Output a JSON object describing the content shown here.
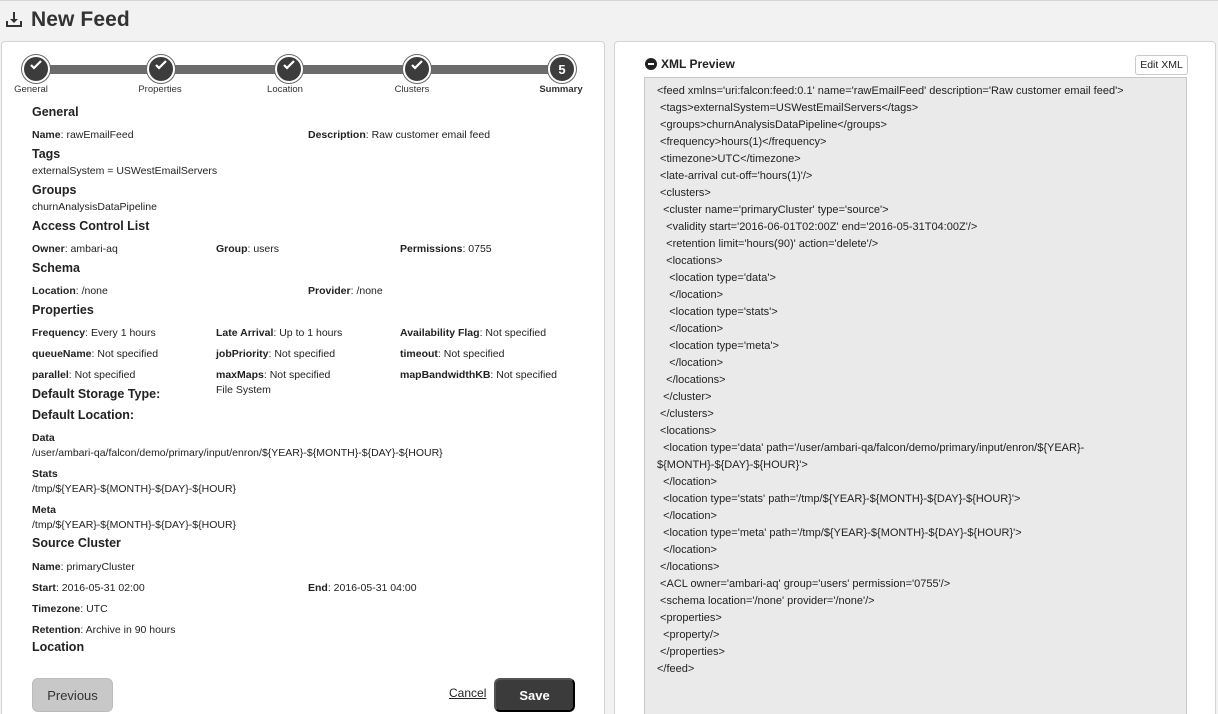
{
  "header": {
    "title": "New Feed",
    "icon": "download-tray-icon"
  },
  "wizard": {
    "steps": [
      {
        "label": "General",
        "state": "done"
      },
      {
        "label": "Properties",
        "state": "done"
      },
      {
        "label": "Location",
        "state": "done"
      },
      {
        "label": "Clusters",
        "state": "done"
      },
      {
        "label": "Summary",
        "state": "current",
        "number": "5"
      }
    ]
  },
  "summary": {
    "general": {
      "title": "General",
      "name_label": "Name",
      "name_value": ": rawEmailFeed",
      "description_label": "Description",
      "description_value": ": Raw customer email feed"
    },
    "tags": {
      "title": "Tags",
      "value": "externalSystem = USWestEmailServers"
    },
    "groups": {
      "title": "Groups",
      "value": "churnAnalysisDataPipeline"
    },
    "acl": {
      "title": "Access Control List",
      "owner_label": "Owner",
      "owner_value": ": ambari-aq",
      "group_label": "Group",
      "group_value": ": users",
      "permissions_label": "Permissions",
      "permissions_value": ": 0755"
    },
    "schema": {
      "title": "Schema",
      "location_label": "Location",
      "location_value": ": /none",
      "provider_label": "Provider",
      "provider_value": ": /none"
    },
    "properties": {
      "title": "Properties",
      "frequency_label": "Frequency",
      "frequency_value": ": Every 1 hours",
      "late_arrival_label": "Late Arrival",
      "late_arrival_value": ": Up to 1 hours",
      "availability_label": "Availability Flag",
      "availability_value": ": Not specified",
      "queue_label": "queueName",
      "queue_value": ": Not specified",
      "priority_label": "jobPriority",
      "priority_value": ": Not specified",
      "timeout_label": "timeout",
      "timeout_value": ": Not specified",
      "parallel_label": "parallel",
      "parallel_value": ": Not specified",
      "maxmaps_label": "maxMaps",
      "maxmaps_value": ": Not specified",
      "bandwidth_label": "mapBandwidthKB",
      "bandwidth_value": ": Not specified"
    },
    "storage_type": {
      "title": "Default Storage Type:",
      "value": "File System"
    },
    "default_location": {
      "title": "Default Location:",
      "data_label": "Data",
      "data_value": "/user/ambari-qa/falcon/demo/primary/input/enron/${YEAR}-${MONTH}-${DAY}-${HOUR}",
      "stats_label": "Stats",
      "stats_value": "/tmp/${YEAR}-${MONTH}-${DAY}-${HOUR}",
      "meta_label": "Meta",
      "meta_value": "/tmp/${YEAR}-${MONTH}-${DAY}-${HOUR}"
    },
    "source_cluster": {
      "title": "Source Cluster",
      "name_label": "Name",
      "name_value": ": primaryCluster",
      "start_label": "Start",
      "start_value": ": 2016-05-31 02:00",
      "end_label": "End",
      "end_value": ": 2016-05-31 04:00",
      "timezone_label": "Timezone",
      "timezone_value": ": UTC",
      "retention_label": "Retention",
      "retention_value": ": Archive in 90 hours"
    },
    "location": {
      "title": "Location"
    }
  },
  "actions": {
    "previous": "Previous",
    "cancel": "Cancel",
    "save": "Save"
  },
  "xml_preview": {
    "title": "XML Preview",
    "edit_label": "Edit XML",
    "lines": [
      "<feed xmlns='uri:falcon:feed:0.1' name='rawEmailFeed' description='Raw customer email feed'>",
      " <tags>externalSystem=USWestEmailServers</tags>",
      " <groups>churnAnalysisDataPipeline</groups>",
      " <frequency>hours(1)</frequency>",
      " <timezone>UTC</timezone>",
      " <late-arrival cut-off='hours(1)'/>",
      " <clusters>",
      "  <cluster name='primaryCluster' type='source'>",
      "   <validity start='2016-06-01T02:00Z' end='2016-05-31T04:00Z'/>",
      "   <retention limit='hours(90)' action='delete'/>",
      "   <locations>",
      "    <location type='data'>",
      "    </location>",
      "    <location type='stats'>",
      "    </location>",
      "    <location type='meta'>",
      "    </location>",
      "   </locations>",
      "  </cluster>",
      " </clusters>",
      " <locations>",
      "  <location type='data' path='/user/ambari-qa/falcon/demo/primary/input/enron/${YEAR}-",
      "${MONTH}-${DAY}-${HOUR}'>",
      "  </location>",
      "  <location type='stats' path='/tmp/${YEAR}-${MONTH}-${DAY}-${HOUR}'>",
      "  </location>",
      "  <location type='meta' path='/tmp/${YEAR}-${MONTH}-${DAY}-${HOUR}'>",
      "  </location>",
      " </locations>",
      " <ACL owner='ambari-aq' group='users' permission='0755'/>",
      " <schema location='/none' provider='/none'/>",
      " <properties>",
      "  <property/>",
      " </properties>",
      "</feed>"
    ]
  }
}
